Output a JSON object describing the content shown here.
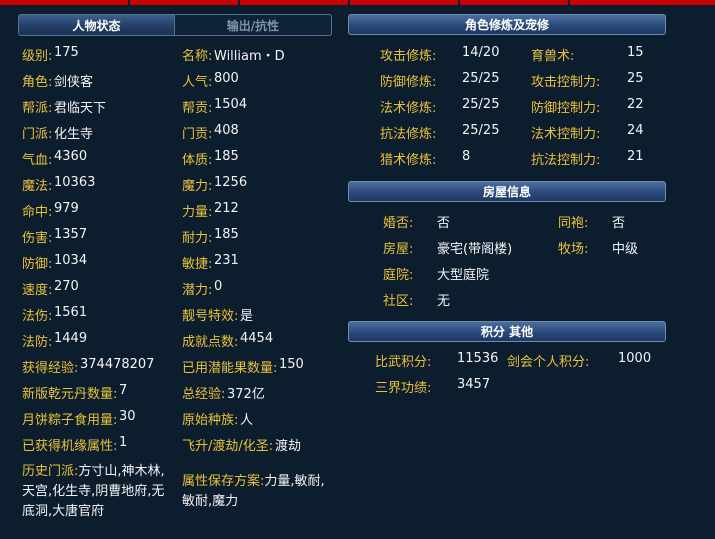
{
  "tabs": [
    {
      "label": "人物状态"
    },
    {
      "label": "输出/抗性"
    }
  ],
  "left": {
    "col1": [
      {
        "label": "级别:",
        "value": "175"
      },
      {
        "label": "角色:",
        "value": "剑侠客"
      },
      {
        "label": "帮派:",
        "value": "君临天下"
      },
      {
        "label": "门派:",
        "value": "化生寺"
      },
      {
        "label": "气血:",
        "value": "4360"
      },
      {
        "label": "魔法:",
        "value": "10363"
      },
      {
        "label": "命中:",
        "value": "979"
      },
      {
        "label": "伤害:",
        "value": "1357"
      },
      {
        "label": "防御:",
        "value": "1034"
      },
      {
        "label": "速度:",
        "value": "270"
      },
      {
        "label": "法伤:",
        "value": "1561"
      },
      {
        "label": "法防:",
        "value": "1449"
      }
    ],
    "col2": [
      {
        "label": "名称:",
        "value": "William・D"
      },
      {
        "label": "人气:",
        "value": "800"
      },
      {
        "label": "帮贡:",
        "value": "1504"
      },
      {
        "label": "门贡:",
        "value": "408"
      },
      {
        "label": "体质:",
        "value": "185"
      },
      {
        "label": "魔力:",
        "value": "1256"
      },
      {
        "label": "力量:",
        "value": "212"
      },
      {
        "label": "耐力:",
        "value": "185"
      },
      {
        "label": "敏捷:",
        "value": "231"
      },
      {
        "label": "潜力:",
        "value": "0"
      },
      {
        "label": "靓号特效:",
        "value": "是"
      },
      {
        "label": "成就点数:",
        "value": "4454"
      }
    ],
    "extra": [
      {
        "label": "获得经验:",
        "value": "374478207",
        "label2": "已用潜能果数量:",
        "value2": "150"
      },
      {
        "label": "新版乾元丹数量:",
        "value": "7",
        "label2": "总经验:",
        "value2": "372亿"
      },
      {
        "label": "月饼粽子食用量:",
        "value": "30",
        "label2": "原始种族:",
        "value2": "人"
      },
      {
        "label": "已获得机缘属性:",
        "value": "1",
        "label2": "飞升/渡劫/化圣:",
        "value2": "渡劫"
      }
    ],
    "history": {
      "label": "历史门派:",
      "value": "方寸山,神木林,天宫,化生寺,阴曹地府,无底洞,大唐官府"
    },
    "scheme": {
      "label": "属性保存方案:",
      "value": "力量,敏耐,敏耐,魔力"
    }
  },
  "cultivation": {
    "title": "角色修炼及宠修",
    "rows": [
      {
        "label": "攻击修炼:",
        "value": "14/20",
        "label2": "育兽术:",
        "value2": "15"
      },
      {
        "label": "防御修炼:",
        "value": "25/25",
        "label2": "攻击控制力:",
        "value2": "25"
      },
      {
        "label": "法术修炼:",
        "value": "25/25",
        "label2": "防御控制力:",
        "value2": "22"
      },
      {
        "label": "抗法修炼:",
        "value": "25/25",
        "label2": "法术控制力:",
        "value2": "24"
      },
      {
        "label": "猎术修炼:",
        "value": "8",
        "label2": "抗法控制力:",
        "value2": "21"
      }
    ]
  },
  "house": {
    "title": "房屋信息",
    "rows": [
      {
        "label": "婚否:",
        "value": "否",
        "label2": "同袍:",
        "value2": "否"
      },
      {
        "label": "房屋:",
        "value": "豪宅(带阁楼)",
        "label2": "牧场:",
        "value2": "中级"
      },
      {
        "label": "庭院:",
        "value": "大型庭院"
      },
      {
        "label": "社区:",
        "value": "无"
      }
    ]
  },
  "points": {
    "title": "积分 其他",
    "rows": [
      {
        "label": "比武积分:",
        "value": "11536",
        "label2": "剑会个人积分:",
        "value2": "1000"
      },
      {
        "label": "三界功绩:",
        "value": "3457"
      }
    ]
  }
}
